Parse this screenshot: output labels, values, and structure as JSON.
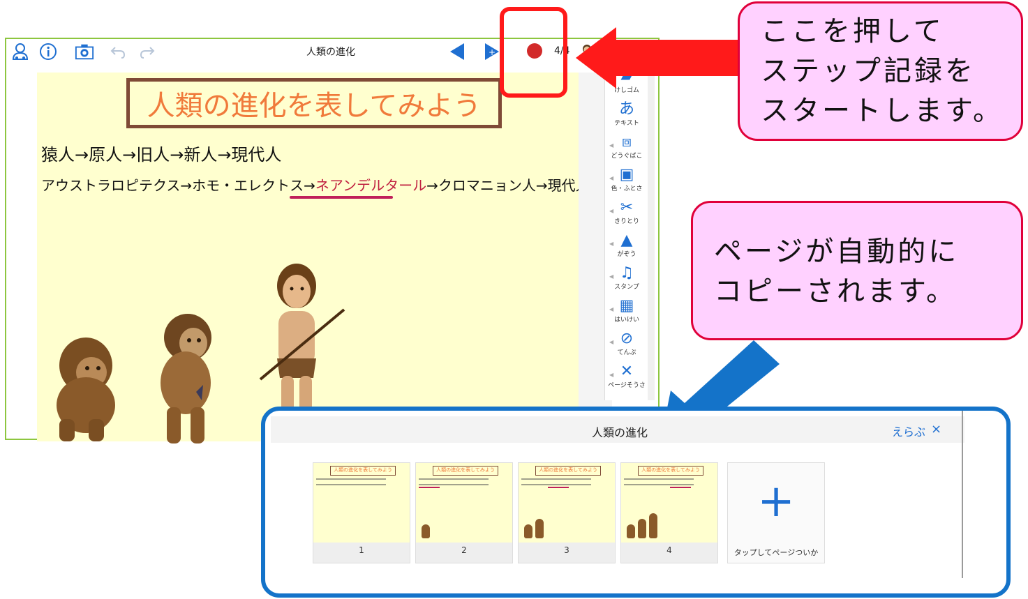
{
  "app": {
    "title": "人類の進化",
    "page_counter": "4/4",
    "toolbar_icons": [
      "user-icon",
      "info-icon",
      "camera-icon",
      "undo-icon",
      "redo-icon",
      "prev-page-icon",
      "next-page-icon",
      "record-icon",
      "avatar-icon"
    ]
  },
  "canvas": {
    "title": "人類の進化を表してみよう",
    "line1": "猿人→原人→旧人→新人→現代人",
    "line2_pre": "アウストラロピテクス→ホモ・エレクトス→",
    "line2_highlight": "ネアンデルタール",
    "line2_post": "→クロマニョン人→現代人",
    "figures": [
      "ape-figure",
      "early-human-figure",
      "caveman-figure"
    ]
  },
  "tools": [
    {
      "label": "けしゴム",
      "icon": "eraser-icon",
      "glyph": "▰"
    },
    {
      "label": "テキスト",
      "icon": "text-icon",
      "glyph": "あ"
    },
    {
      "label": "どうぐばこ",
      "icon": "toolbox-icon",
      "glyph": "⧈"
    },
    {
      "label": "色・ふとさ",
      "icon": "color-width-icon",
      "glyph": "▣"
    },
    {
      "label": "きりとり",
      "icon": "scissors-icon",
      "glyph": "✂"
    },
    {
      "label": "がぞう",
      "icon": "image-icon",
      "glyph": "▲"
    },
    {
      "label": "スタンプ",
      "icon": "stamp-icon",
      "glyph": "♫"
    },
    {
      "label": "はいけい",
      "icon": "background-icon",
      "glyph": "▦"
    },
    {
      "label": "てんぷ",
      "icon": "paperclip-icon",
      "glyph": "⊘"
    },
    {
      "label": "ページそうさ",
      "icon": "page-tools-icon",
      "glyph": "✕"
    }
  ],
  "callouts": {
    "bubble1": "ここを押して\nステップ記録を\nスタートします。",
    "bubble2": "ページが自動的に\nコピーされます。"
  },
  "page_panel": {
    "title": "人類の進化",
    "select_label": "えらぶ",
    "close_label": "×",
    "pages": [
      {
        "number": "1",
        "figures": 0
      },
      {
        "number": "2",
        "figures": 1
      },
      {
        "number": "3",
        "figures": 2
      },
      {
        "number": "4",
        "figures": 3
      }
    ],
    "thumb_title": "人類の進化を表してみよう",
    "add_label": "タップしてページついか",
    "add_icon": "plus-icon"
  },
  "colors": {
    "accent": "#1f6fd1",
    "record": "#d22a2a",
    "window_border": "#8dc63f",
    "panel_border": "#1473c9",
    "callout_fill": "#ffd1ff",
    "callout_border": "#e0003a",
    "arrow_red": "#ff1a1a"
  }
}
